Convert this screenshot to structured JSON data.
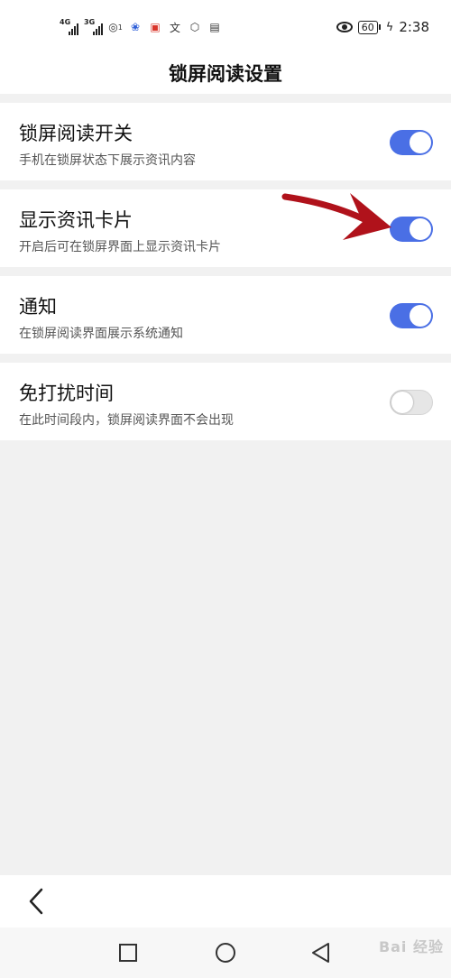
{
  "status_bar": {
    "signal_1_tag": "4G",
    "signal_2_tag": "3G",
    "hotspot_badge": "1",
    "battery_level": "60",
    "time": "2:38"
  },
  "header": {
    "title": "锁屏阅读设置"
  },
  "settings": [
    {
      "title": "锁屏阅读开关",
      "subtitle": "手机在锁屏状态下展示资讯内容",
      "enabled": true
    },
    {
      "title": "显示资讯卡片",
      "subtitle": "开启后可在锁屏界面上显示资讯卡片",
      "enabled": true
    },
    {
      "title": "通知",
      "subtitle": "在锁屏阅读界面展示系统通知",
      "enabled": true
    },
    {
      "title": "免打扰时间",
      "subtitle": "在此时间段内，锁屏阅读界面不会出现",
      "enabled": false
    }
  ],
  "colors": {
    "accent": "#4a6fe5",
    "annotation_arrow": "#b0121b",
    "page_background": "#f1f1f1"
  },
  "watermark": {
    "text": "Bai 经验"
  }
}
